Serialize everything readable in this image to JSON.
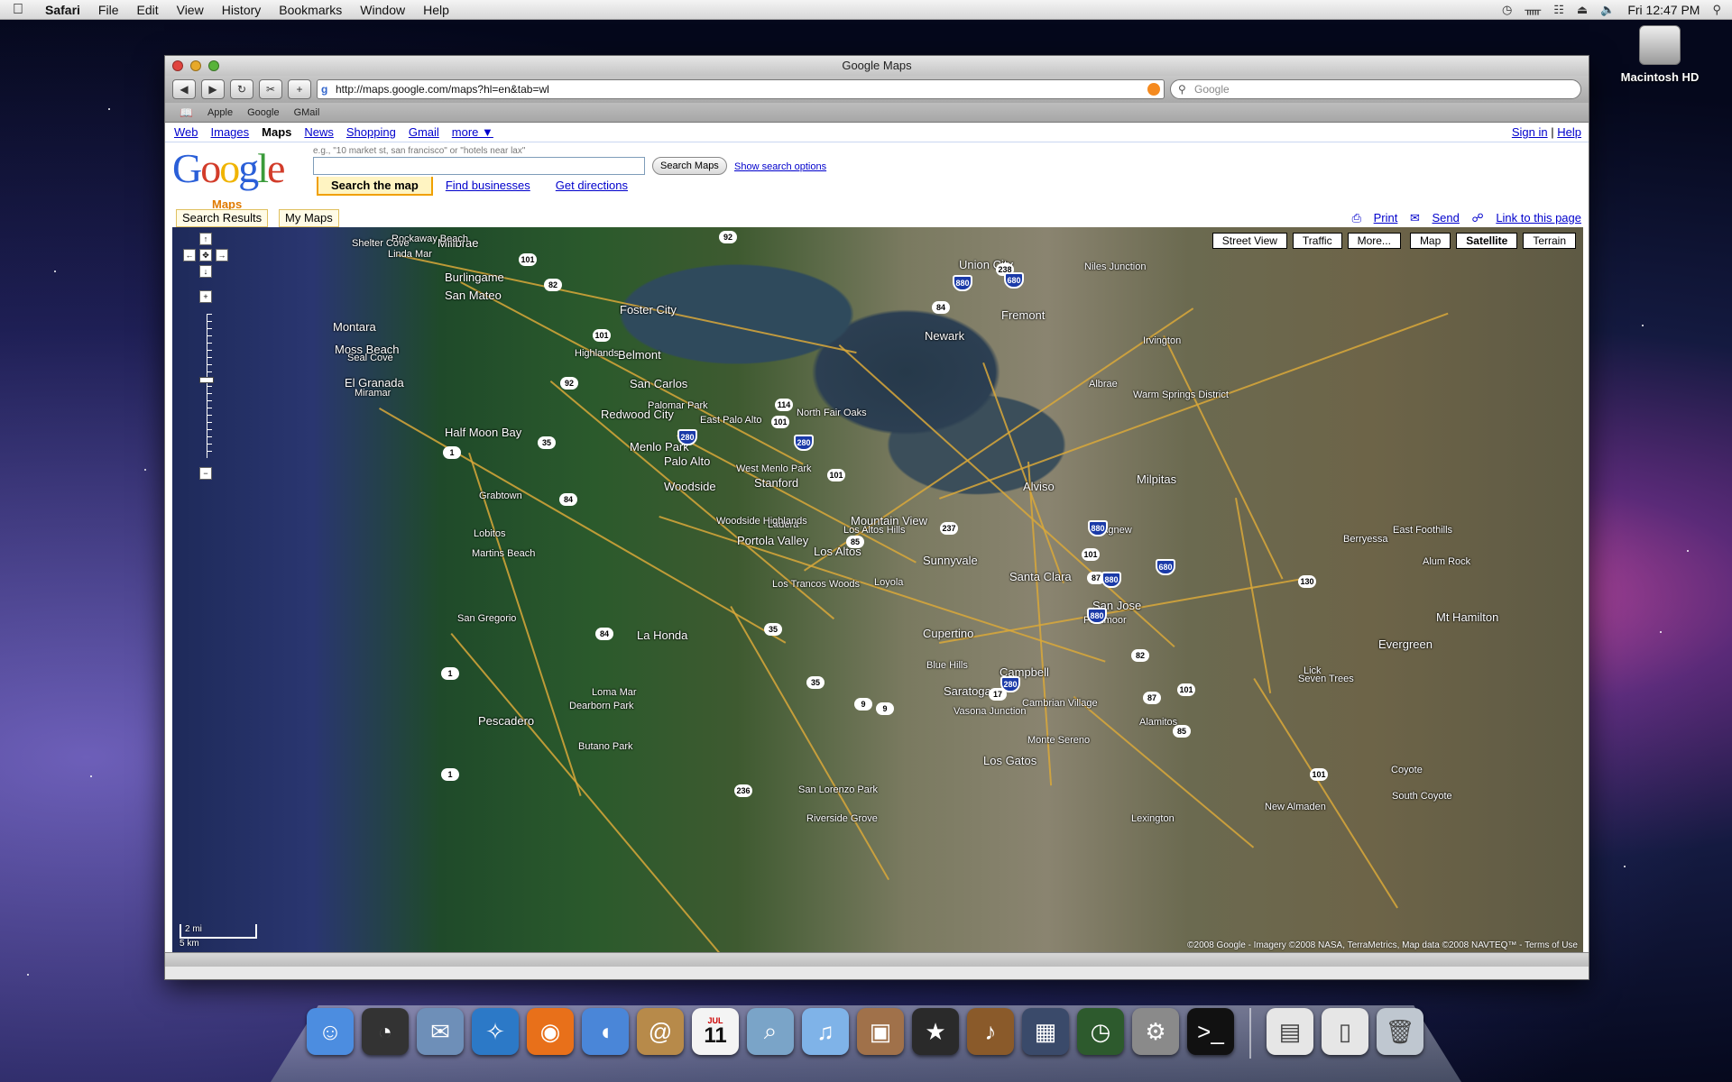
{
  "menubar": {
    "app": "Safari",
    "items": [
      "File",
      "Edit",
      "View",
      "History",
      "Bookmarks",
      "Window",
      "Help"
    ],
    "clock": "Fri 12:47 PM"
  },
  "desktop": {
    "drive_label": "Macintosh HD"
  },
  "window": {
    "title": "Google Maps",
    "url": "http://maps.google.com/maps?hl=en&tab=wl",
    "search_placeholder": "Google",
    "bookmarks": [
      "Apple",
      "Google",
      "GMail"
    ]
  },
  "google_nav": {
    "links": [
      "Web",
      "Images",
      "Maps",
      "News",
      "Shopping",
      "Gmail",
      "more ▼"
    ],
    "current": "Maps",
    "sign_in": "Sign in",
    "separator": "|",
    "help": "Help"
  },
  "search": {
    "logo_text": "Google",
    "logo_sub": "Maps",
    "hint": "e.g., \"10 market st, san francisco\" or \"hotels near lax\"",
    "query": "",
    "button": "Search Maps",
    "options_link": "Show search options",
    "tabs": [
      "Search the map",
      "Find businesses",
      "Get directions"
    ]
  },
  "panel": {
    "tabs": [
      "Search Results",
      "My Maps"
    ],
    "links": [
      "Print",
      "Send",
      "Link to this page"
    ]
  },
  "map": {
    "view_buttons": [
      "Street View",
      "Traffic",
      "More..."
    ],
    "type_buttons": [
      "Map",
      "Satellite",
      "Terrain"
    ],
    "selected_type": "Satellite",
    "scale": [
      "2 mi",
      "5 km"
    ],
    "copyright": "©2008 Google - Imagery ©2008 NASA, TerraMetrics, Map data ©2008 NAVTEQ™ - Terms of Use",
    "labels": [
      "Millbrae",
      "Burlingame",
      "San Mateo",
      "Foster City",
      "Belmont",
      "San Carlos",
      "Redwood City",
      "Menlo Park",
      "East Palo Alto",
      "Palo Alto",
      "Stanford",
      "Mountain View",
      "Los Altos",
      "Sunnyvale",
      "Santa Clara",
      "San Jose",
      "Cupertino",
      "Campbell",
      "Saratoga",
      "Los Gatos",
      "Monte Sereno",
      "Milpitas",
      "Fremont",
      "Newark",
      "Union City",
      "Alviso",
      "Half Moon Bay",
      "El Granada",
      "Montara",
      "Moss Beach",
      "Woodside",
      "Portola Valley",
      "La Honda",
      "San Gregorio",
      "Pescadero",
      "Loma Mar",
      "Evergreen",
      "Mt Hamilton",
      "Alum Rock",
      "Berryessa",
      "Coyote",
      "Seven Trees",
      "Los Altos Hills",
      "Ladera",
      "Woodside Highlands",
      "Rockaway Beach",
      "Linda Mar",
      "Shelter Cove",
      "Seal Cove",
      "Miramar",
      "Lobitos",
      "Martins Beach",
      "Grabtown",
      "Palomar Park",
      "Highlands",
      "North Fair Oaks",
      "West Menlo Park",
      "Loyola",
      "Los Trancos Woods",
      "Blue Hills",
      "Vasona Junction",
      "Cambrian Village",
      "Alamitos",
      "Parkmoor",
      "Agnew",
      "Warm Springs District",
      "Niles Junction",
      "Irvington",
      "Butano Park",
      "Dearborn Park",
      "San Lorenzo Park",
      "Riverside Grove",
      "New Almaden",
      "South Coyote",
      "East Foothills",
      "Lick",
      "Albrae",
      "Lexington"
    ],
    "shields": [
      "92",
      "101",
      "82",
      "101",
      "92",
      "35",
      "84",
      "114",
      "101",
      "280",
      "101",
      "237",
      "85",
      "880",
      "84",
      "238",
      "680",
      "880",
      "680",
      "101",
      "87",
      "880",
      "280",
      "17",
      "87",
      "82",
      "101",
      "85",
      "9",
      "35",
      "35",
      "84",
      "1",
      "1",
      "1",
      "236",
      "9",
      "130",
      "101",
      "280",
      "880"
    ]
  },
  "dock": {
    "icons": [
      "finder-icon",
      "dashboard-icon",
      "mail-icon",
      "safari-icon",
      "firefox-icon",
      "ichat-icon",
      "addressbook-icon",
      "ical-icon",
      "preview-icon",
      "itunes-icon",
      "iphoto-icon",
      "imovie-icon",
      "garageband-icon",
      "spaces-icon",
      "timemachine-icon",
      "systemprefs-icon",
      "terminal-icon",
      "pdf-icon",
      "document-icon",
      "trash-icon"
    ],
    "ical_month": "JUL",
    "ical_day": "11"
  },
  "colors": {
    "link": "#0000cc",
    "tab_highlight": "#f0a000",
    "road": "#d9a83a",
    "interstate_shield": "#1a3aa8"
  }
}
